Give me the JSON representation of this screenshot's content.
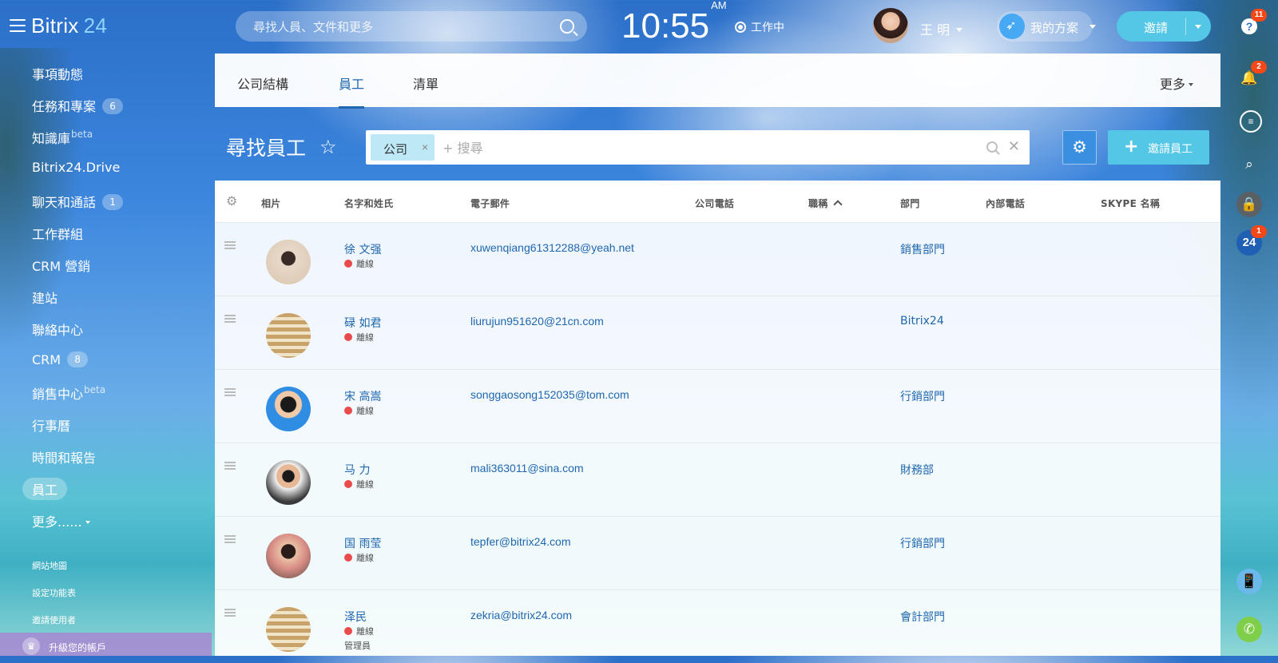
{
  "header": {
    "logo_text": "Bitrix",
    "logo_num": "24",
    "search_placeholder": "尋找人員、文件和更多",
    "time": "10:55",
    "ampm": "AM",
    "work_status": "工作中",
    "user_name": "王 明",
    "plan_label": "我的方案",
    "invite_label": "邀請"
  },
  "rail": {
    "help_badge": "11",
    "notify_badge": "2",
    "b24_badge": "1",
    "b24_label": "24"
  },
  "sidebar": {
    "items": [
      {
        "label": "事項動態",
        "count": "",
        "sup": ""
      },
      {
        "label": "任務和專案",
        "count": "6",
        "sup": ""
      },
      {
        "label": "知識庫",
        "count": "",
        "sup": "beta"
      },
      {
        "label": "Bitrix24.Drive",
        "count": "",
        "sup": ""
      },
      {
        "label": "聊天和通話",
        "count": "1",
        "sup": ""
      },
      {
        "label": "工作群組",
        "count": "",
        "sup": ""
      },
      {
        "label": "CRM 營銷",
        "count": "",
        "sup": ""
      },
      {
        "label": "建站",
        "count": "",
        "sup": ""
      },
      {
        "label": "聯絡中心",
        "count": "",
        "sup": ""
      },
      {
        "label": "CRM",
        "count": "8",
        "sup": ""
      },
      {
        "label": "銷售中心",
        "count": "",
        "sup": "beta"
      },
      {
        "label": "行事曆",
        "count": "",
        "sup": ""
      },
      {
        "label": "時間和報告",
        "count": "",
        "sup": ""
      },
      {
        "label": "員工",
        "count": "",
        "sup": ""
      },
      {
        "label": "更多......",
        "count": "",
        "sup": ""
      }
    ],
    "links": [
      "網站地圖",
      "設定功能表",
      "邀請使用者"
    ],
    "upgrade_label": "升級您的帳戶"
  },
  "tabs": {
    "items": [
      "公司結構",
      "員工",
      "清單"
    ],
    "more_label": "更多"
  },
  "toolbar": {
    "page_title": "尋找員工",
    "chip_label": "公司",
    "chip_remove": "×",
    "filter_placeholder": "+ 搜尋",
    "invite_employee_label": "邀請員工"
  },
  "table": {
    "headers": {
      "photo": "相片",
      "name": "名字和姓氏",
      "email": "電子郵件",
      "company_phone": "公司電話",
      "position": "職稱",
      "department": "部門",
      "internal_phone": "內部電話",
      "skype": "SKYPE 名稱"
    },
    "rows": [
      {
        "name": "徐 文强",
        "status": "離線",
        "role": "",
        "email": "xuwenqiang61312288@yeah.net",
        "dept": "銷售部門"
      },
      {
        "name": "碌 如君",
        "status": "離線",
        "role": "",
        "email": "liurujun951620@21cn.com",
        "dept": "Bitrix24"
      },
      {
        "name": "宋 高嵩",
        "status": "離線",
        "role": "",
        "email": "songgaosong152035@tom.com",
        "dept": "行銷部門"
      },
      {
        "name": "马 力",
        "status": "離線",
        "role": "",
        "email": "mali363011@sina.com",
        "dept": "財務部"
      },
      {
        "name": "国 雨莹",
        "status": "離線",
        "role": "",
        "email": "tepfer@bitrix24.com",
        "dept": "行銷部門"
      },
      {
        "name": "泽民",
        "status": "離線",
        "role": "管理員",
        "email": "zekria@bitrix24.com",
        "dept": "會計部門"
      }
    ]
  }
}
